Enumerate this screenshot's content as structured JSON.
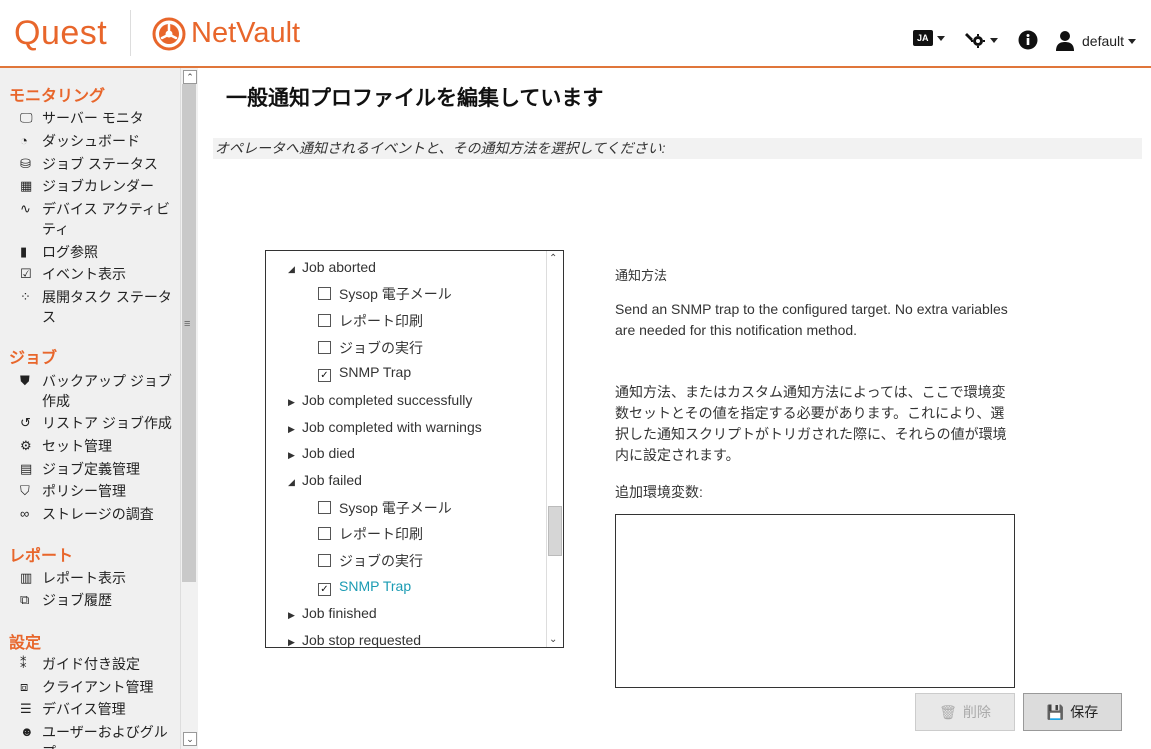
{
  "header": {
    "brand": "Quest",
    "product": "NetVault",
    "language": "JA",
    "user": "default",
    "icons": [
      "language-icon",
      "tools-icon",
      "info-icon",
      "user-icon"
    ]
  },
  "sidebar": {
    "sections": [
      {
        "title": "モニタリング",
        "items": [
          {
            "label": "サーバー モニタ",
            "icon": "monitor-icon"
          },
          {
            "label": "ダッシュボード",
            "icon": "dashboard-icon"
          },
          {
            "label": "ジョブ ステータス",
            "icon": "job-status-icon"
          },
          {
            "label": "ジョブカレンダー",
            "icon": "calendar-icon"
          },
          {
            "label": "デバイス アクティビ",
            "label2": "ティ",
            "icon": "activity-icon"
          },
          {
            "label": "ログ参照",
            "icon": "log-icon"
          },
          {
            "label": "イベント表示",
            "icon": "event-icon"
          },
          {
            "label": "展開タスク ステータ",
            "label2": "ス",
            "icon": "deploy-icon"
          }
        ]
      },
      {
        "title": "ジョブ",
        "items": [
          {
            "label": "バックアップ ジョブ",
            "label2": "作成",
            "icon": "backup-icon"
          },
          {
            "label": "リストア ジョブ作成",
            "icon": "restore-icon"
          },
          {
            "label": "セット管理",
            "icon": "sets-icon"
          },
          {
            "label": "ジョブ定義管理",
            "icon": "job-definition-icon"
          },
          {
            "label": "ポリシー管理",
            "icon": "policy-icon"
          },
          {
            "label": "ストレージの調査",
            "icon": "binoculars-icon"
          }
        ]
      },
      {
        "title": "レポート",
        "items": [
          {
            "label": "レポート表示",
            "icon": "report-icon"
          },
          {
            "label": "ジョブ履歴",
            "icon": "history-icon"
          }
        ]
      },
      {
        "title": "設定",
        "items": [
          {
            "label": "ガイド付き設定",
            "icon": "footsteps-icon"
          },
          {
            "label": "クライアント管理",
            "icon": "client-icon"
          },
          {
            "label": "デバイス管理",
            "icon": "device-icon"
          },
          {
            "label": "ユーザーおよびグルー",
            "label2": "プ",
            "icon": "users-icon"
          }
        ]
      }
    ]
  },
  "main": {
    "title": "一般通知プロファイルを編集しています",
    "subtitle": "オペレータへ通知されるイベントと、その通知方法を選択してください:",
    "tree": {
      "nodes": [
        {
          "label": "Job aborted",
          "expanded": true,
          "children": [
            {
              "label": "Sysop 電子メール",
              "checked": false
            },
            {
              "label": "レポート印刷",
              "checked": false
            },
            {
              "label": "ジョブの実行",
              "checked": false
            },
            {
              "label": "SNMP Trap",
              "checked": true
            }
          ]
        },
        {
          "label": "Job completed successfully",
          "expanded": false
        },
        {
          "label": "Job completed with warnings",
          "expanded": false
        },
        {
          "label": "Job died",
          "expanded": false
        },
        {
          "label": "Job failed",
          "expanded": true,
          "children": [
            {
              "label": "Sysop 電子メール",
              "checked": false
            },
            {
              "label": "レポート印刷",
              "checked": false
            },
            {
              "label": "ジョブの実行",
              "checked": false
            },
            {
              "label": "SNMP Trap",
              "checked": true,
              "selected": true
            }
          ]
        },
        {
          "label": "Job finished",
          "expanded": false
        },
        {
          "label": "Job stop requested",
          "expanded": false
        }
      ]
    },
    "info": {
      "title": "通知方法",
      "description": "Send an SNMP trap to the configured target. No extra variables are needed for this notification method.",
      "env_help": "通知方法、またはカスタム通知方法によっては、ここで環境変数セットとその値を指定する必要があります。これにより、選択した通知スクリプトがトリガされた際に、それらの値が環境内に設定されます。",
      "env_label": "追加環境変数:",
      "env_value": ""
    },
    "buttons": {
      "delete": "削除",
      "save": "保存"
    }
  },
  "colors": {
    "brand": "#e8662b",
    "link_active": "#1a9bb3"
  }
}
